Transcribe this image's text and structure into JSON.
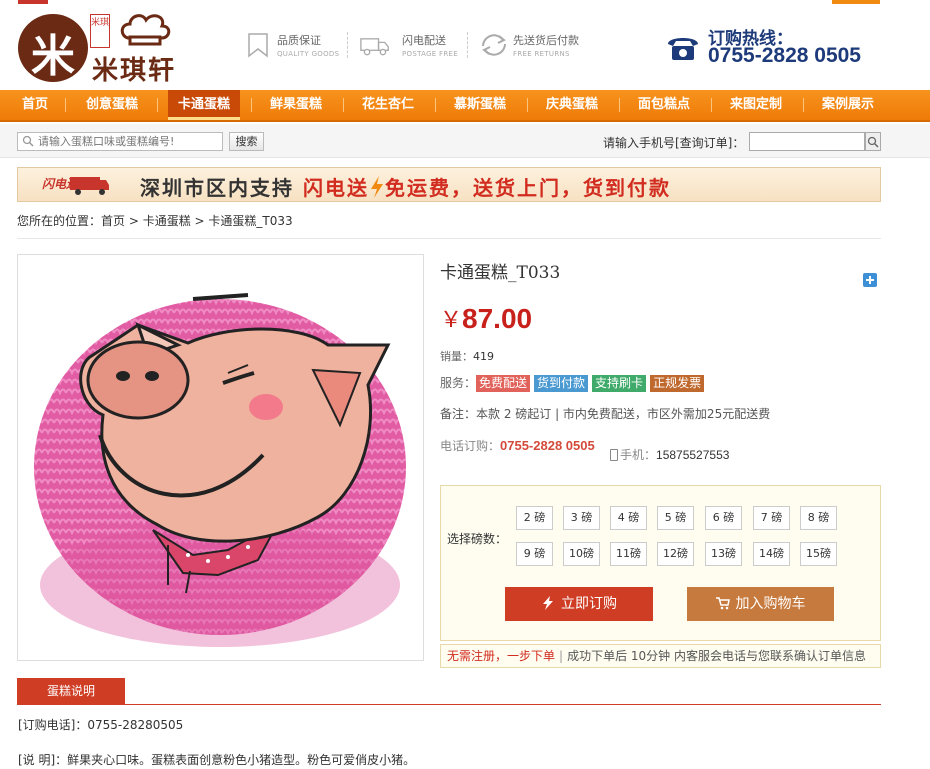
{
  "brand": {
    "seal_text": "米琪",
    "name": "米琪轩"
  },
  "features": [
    {
      "title": "品质保证",
      "subtitle": "QUALITY GOODS",
      "icon": "bookmark-icon"
    },
    {
      "title": "闪电配送",
      "subtitle": "POSTAGE FREE",
      "icon": "truck-icon"
    },
    {
      "title": "先送货后付款",
      "subtitle": "FREE RETURNS",
      "icon": "return-icon"
    }
  ],
  "hotline": {
    "label": "订购热线：",
    "number": "0755-2828 0505"
  },
  "nav": {
    "items": [
      "首页",
      "创意蛋糕",
      "卡通蛋糕",
      "鲜果蛋糕",
      "花生杏仁",
      "慕斯蛋糕",
      "庆典蛋糕",
      "面包糕点",
      "来图定制",
      "案例展示"
    ],
    "active_index": 2
  },
  "search": {
    "placeholder": "请输入蛋糕口味或蛋糕编号!",
    "button": "搜索",
    "order_query_label": "请输入手机号[查询订单]："
  },
  "banner": {
    "logo_text": "闪电送",
    "text_prefix": "深圳市区内支持",
    "text_highlight": "闪电送",
    "text_suffix": "免运费，送货上门，货到付款"
  },
  "breadcrumb": {
    "prefix": "您所在的位置：",
    "items": [
      "首页",
      "卡通蛋糕",
      "卡通蛋糕_T033"
    ]
  },
  "product": {
    "title": "卡通蛋糕_T033",
    "currency": "￥",
    "price": "87.00",
    "sales_label": "销量：",
    "sales_value": "419",
    "service_label": "服务：",
    "tags": [
      {
        "text": "免费配送",
        "color": "#e0625a"
      },
      {
        "text": "货到付款",
        "color": "#4a9ad1"
      },
      {
        "text": "支持刷卡",
        "color": "#3faa6a"
      },
      {
        "text": "正规发票",
        "color": "#c0692e"
      }
    ],
    "note": "备注：本款 2 磅起订 | 市内免费配送，市区外需加25元配送费",
    "phone_order_label": "电话订购：",
    "phone_order_number": "0755-2828 0505",
    "mobile_label": "手机：",
    "mobile_number": "15875527553"
  },
  "weights": {
    "label": "选择磅数：",
    "options": [
      "2 磅",
      "3 磅",
      "4 磅",
      "5 磅",
      "6 磅",
      "7 磅",
      "8 磅",
      "9 磅",
      "10磅",
      "11磅",
      "12磅",
      "13磅",
      "14磅",
      "15磅"
    ],
    "buy_button": "立即订购",
    "cart_button": "加入购物车"
  },
  "tip": {
    "highlight": "无需注册，一步下单",
    "separator": "|",
    "text": "成功下单后 10分钟 内客服会电话与您联系确认订单信息"
  },
  "description": {
    "tab": "蛋糕说明",
    "line1": "[订购电话]：0755-28280505",
    "line2": "[说 明]：鲜果夹心口味。蛋糕表面创意粉色小猪造型。粉色可爱俏皮小猪。"
  }
}
